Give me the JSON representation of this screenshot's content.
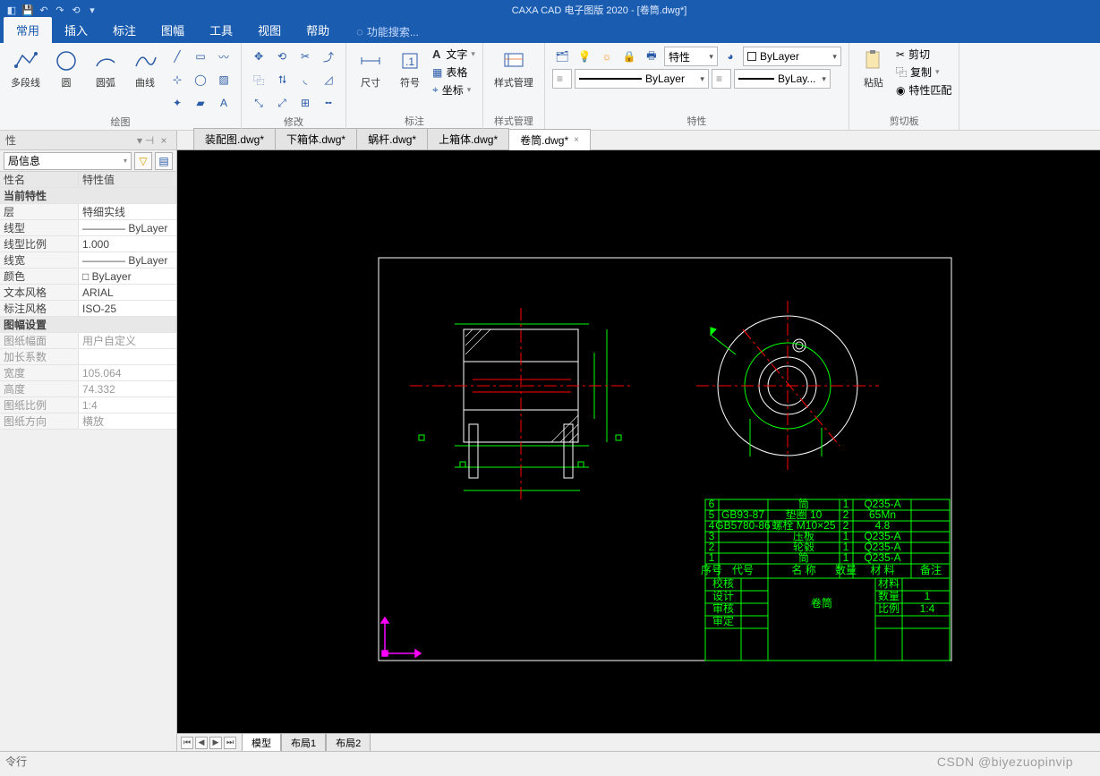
{
  "app": {
    "title": "CAXA CAD 电子图版 2020 - [卷筒.dwg*]"
  },
  "menu": {
    "tabs": [
      "常用",
      "插入",
      "标注",
      "图幅",
      "工具",
      "视图",
      "帮助"
    ],
    "active": 0,
    "search_placeholder": "功能搜索..."
  },
  "ribbon": {
    "draw": {
      "label": "绘图",
      "polyline": "多段线",
      "circle": "圆",
      "arc": "圆弧",
      "curve": "曲线"
    },
    "modify": {
      "label": "修改"
    },
    "annotate": {
      "label": "标注",
      "dim": "尺寸",
      "symbol": "符号",
      "text": "文字",
      "table": "表格",
      "coord": "坐标"
    },
    "style": {
      "label": "样式管理",
      "btn": "样式管理"
    },
    "props": {
      "label": "特性",
      "colorcombo": "■ ByLayer",
      "special": "特性",
      "layer": "ByLayer",
      "lineweight": "ByLay..."
    },
    "clip": {
      "label": "剪切板",
      "paste": "粘贴",
      "cut": "剪切",
      "copy": "复制",
      "match": "特性匹配"
    }
  },
  "doctabs": {
    "tabs": [
      "装配图.dwg*",
      "下箱体.dwg*",
      "蜗杆.dwg*",
      "上箱体.dwg*",
      "卷筒.dwg*"
    ],
    "active": 4
  },
  "proppanel": {
    "title": "性",
    "combo": "局信息",
    "header": {
      "name": "性名",
      "value": "特性值"
    },
    "sections": [
      {
        "title": "当前特性",
        "rows": [
          {
            "n": "层",
            "v": "特细实线"
          },
          {
            "n": "线型",
            "v": "———— ByLayer"
          },
          {
            "n": "线型比例",
            "v": "1.000"
          },
          {
            "n": "线宽",
            "v": "———— ByLayer"
          },
          {
            "n": "颜色",
            "v": "□ ByLayer"
          },
          {
            "n": "文本风格",
            "v": "ARIAL"
          },
          {
            "n": "标注风格",
            "v": "ISO-25"
          }
        ]
      },
      {
        "title": "图幅设置",
        "rows": [
          {
            "n": "图纸幅面",
            "v": "用户自定义",
            "g": true
          },
          {
            "n": "加长系数",
            "v": "",
            "g": true
          },
          {
            "n": "宽度",
            "v": "105.064",
            "g": true
          },
          {
            "n": "高度",
            "v": "74.332",
            "g": true
          },
          {
            "n": "图纸比例",
            "v": "1:4",
            "g": true
          },
          {
            "n": "图纸方向",
            "v": "横放",
            "g": true
          }
        ]
      }
    ]
  },
  "layouts": {
    "tabs": [
      "模型",
      "布局1",
      "布局2"
    ],
    "active": 0
  },
  "cmdline": {
    "label": "令行"
  },
  "titleblock": {
    "rows": [
      {
        "no": "6",
        "code": "",
        "name": "筒",
        "qty": "1",
        "mat": "Q235-A"
      },
      {
        "no": "5",
        "code": "GB93-87",
        "name": "垫圈 10",
        "qty": "2",
        "mat": "65Mn"
      },
      {
        "no": "4",
        "code": "GB5780-86",
        "name": "螺栓 M10×25",
        "qty": "2",
        "mat": "4.8"
      },
      {
        "no": "3",
        "code": "",
        "name": "压板",
        "qty": "1",
        "mat": "Q235-A"
      },
      {
        "no": "2",
        "code": "",
        "name": "轮毂",
        "qty": "1",
        "mat": "Q235-A"
      },
      {
        "no": "1",
        "code": "",
        "name": "筒",
        "qty": "1",
        "mat": "Q235-A"
      }
    ],
    "hdr": {
      "no": "序号",
      "code": "代号",
      "name": "名   称",
      "qty": "数量",
      "mat": "材  料",
      "note": "备注"
    },
    "main": {
      "title": "卷筒",
      "mat": "材料",
      "qty": "数量",
      "qtyv": "1",
      "scale": "比例",
      "scalev": "1:4"
    },
    "left": [
      "校核",
      "设计",
      "审核",
      "审定"
    ]
  },
  "watermark": "CSDN @biyezuopinvip"
}
